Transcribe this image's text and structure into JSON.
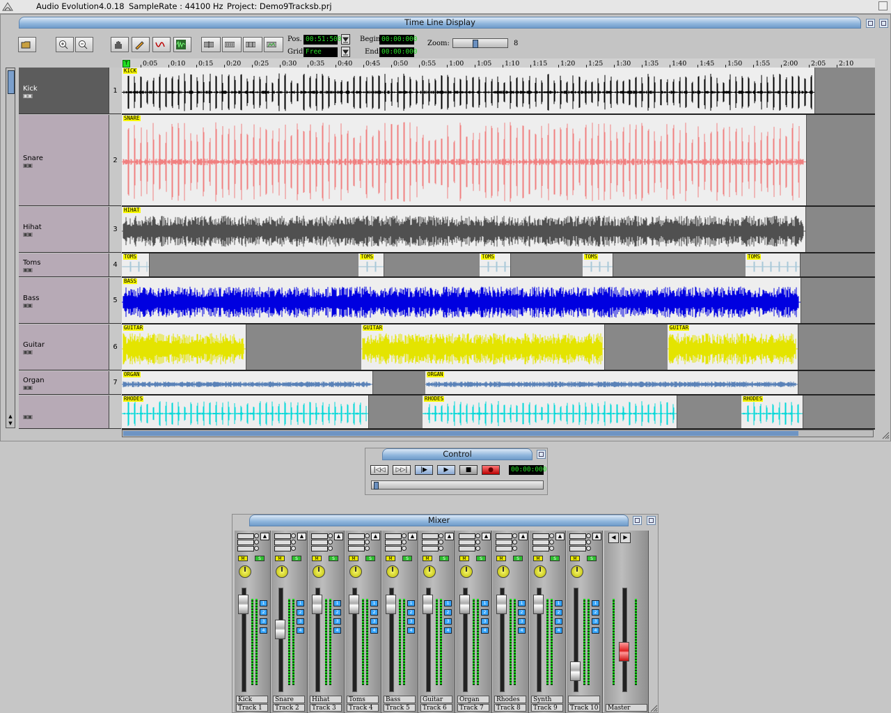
{
  "titlebar": {
    "app": "Audio Evolution4.0.18",
    "samplerate": "SampleRate : 44100 Hz",
    "project": "Project: Demo9Tracksb.prj"
  },
  "timeline": {
    "title": "Time Line Display",
    "pos_label": "Pos.",
    "pos_value": "00:51:500",
    "grid_label": "Grid",
    "grid_value": "Free",
    "begin_label": "Begin",
    "begin_value": "00:00:000",
    "end_label": "End",
    "end_value": "00:00:000",
    "zoom_label": "Zoom:",
    "zoom_value": "8",
    "ruler_marker": "T",
    "ruler_ticks": [
      "0:05",
      "0:10",
      "0:15",
      "0:20",
      "0:25",
      "0:30",
      "0:35",
      "0:40",
      "0:45",
      "0:50",
      "0:55",
      "1:00",
      "1:05",
      "1:10",
      "1:15",
      "1:20",
      "1:25",
      "1:30",
      "1:35",
      "1:40",
      "1:45",
      "1:50",
      "1:55",
      "2:00",
      "2:05",
      "2:10"
    ],
    "tracks": [
      {
        "name": "Kick",
        "num": "1",
        "clips": [
          {
            "label": "KICK"
          }
        ]
      },
      {
        "name": "Snare",
        "num": "2",
        "clips": [
          {
            "label": "SNARE"
          }
        ]
      },
      {
        "name": "Hihat",
        "num": "3",
        "clips": [
          {
            "label": "HIHAT"
          }
        ]
      },
      {
        "name": "Toms",
        "num": "4",
        "clips": [
          {
            "label": "TOMS"
          },
          {
            "label": "TOMS"
          },
          {
            "label": "TOMS"
          },
          {
            "label": "TOMS"
          },
          {
            "label": "TOMS"
          }
        ]
      },
      {
        "name": "Bass",
        "num": "5",
        "clips": [
          {
            "label": "BASS"
          }
        ]
      },
      {
        "name": "Guitar",
        "num": "6",
        "clips": [
          {
            "label": "GUITAR"
          },
          {
            "label": "GUITAR"
          },
          {
            "label": "GUITAR"
          }
        ]
      },
      {
        "name": "Organ",
        "num": "7",
        "clips": [
          {
            "label": "ORGAN"
          },
          {
            "label": "ORGAN"
          }
        ]
      },
      {
        "name": "",
        "num": "",
        "clips": [
          {
            "label": "RHODES"
          },
          {
            "label": "RHODES"
          },
          {
            "label": "RHODES"
          }
        ]
      }
    ]
  },
  "control": {
    "title": "Control",
    "time": "00:00:000",
    "buttons": [
      "rewind",
      "fast-forward",
      "play-loop",
      "play",
      "stop",
      "record"
    ]
  },
  "mixer": {
    "title": "Mixer",
    "mute_label": "M",
    "solo_label": "S",
    "bus_labels": [
      "1",
      "2",
      "3",
      "4"
    ],
    "channels": [
      {
        "name": "Kick",
        "track": "Track 1",
        "fader": 0.92
      },
      {
        "name": "Snare",
        "track": "Track 2",
        "fader": 0.62
      },
      {
        "name": "Hihat",
        "track": "Track 3",
        "fader": 0.92
      },
      {
        "name": "Toms",
        "track": "Track 4",
        "fader": 0.92
      },
      {
        "name": "Bass",
        "track": "Track 5",
        "fader": 0.92
      },
      {
        "name": "Guitar",
        "track": "Track 6",
        "fader": 0.92
      },
      {
        "name": "Organ",
        "track": "Track 7",
        "fader": 0.92
      },
      {
        "name": "Rhodes",
        "track": "Track 8",
        "fader": 0.92
      },
      {
        "name": "Synth",
        "track": "Track 9",
        "fader": 0.92
      },
      {
        "name": "",
        "track": "Track 10",
        "fader": 0.12
      }
    ],
    "master_label": "Master",
    "master_fader": 0.35
  },
  "colors": {
    "kick": "#000000",
    "snare": "#f08080",
    "hihat": "#505050",
    "toms": "#a8c8d8",
    "bass": "#0000e0",
    "guitar": "#e4e400",
    "organ": "#5a82b8",
    "rhodes": "#00d8d8",
    "selected_header": "#5c5c5c",
    "track_header": "#b7aab6",
    "lcd_text": "#28e028"
  }
}
